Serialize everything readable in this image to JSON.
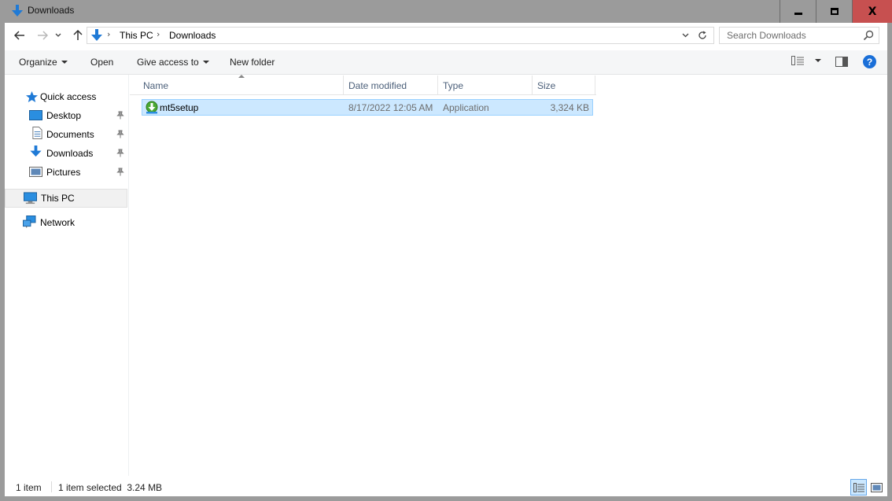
{
  "window": {
    "title": "Downloads",
    "controls": {
      "minimize": "minimize",
      "maximize": "maximize",
      "close": "X"
    }
  },
  "address": {
    "segments": [
      "This PC",
      "Downloads"
    ],
    "search_placeholder": "Search Downloads"
  },
  "commands": {
    "organize": "Organize",
    "open": "Open",
    "give_access": "Give access to",
    "new_folder": "New folder",
    "help": "?"
  },
  "nav": {
    "quick_access": "Quick access",
    "items": [
      {
        "label": "Desktop",
        "icon": "desktop-icon",
        "pinned": true
      },
      {
        "label": "Documents",
        "icon": "documents-icon",
        "pinned": true
      },
      {
        "label": "Downloads",
        "icon": "downloads-icon",
        "pinned": true
      },
      {
        "label": "Pictures",
        "icon": "pictures-icon",
        "pinned": true
      }
    ],
    "this_pc": "This PC",
    "network": "Network"
  },
  "columns": {
    "name": "Name",
    "date": "Date modified",
    "type": "Type",
    "size": "Size"
  },
  "files": [
    {
      "name": "mt5setup",
      "date": "8/17/2022 12:05 AM",
      "type": "Application",
      "size": "3,324 KB",
      "selected": true
    }
  ],
  "status": {
    "count": "1 item",
    "selection": "1 item selected  3.24 MB"
  },
  "colors": {
    "accent": "#1a6fd8",
    "selection_fill": "#cce8ff",
    "selection_border": "#99d1ff",
    "close_button": "#c75050"
  }
}
